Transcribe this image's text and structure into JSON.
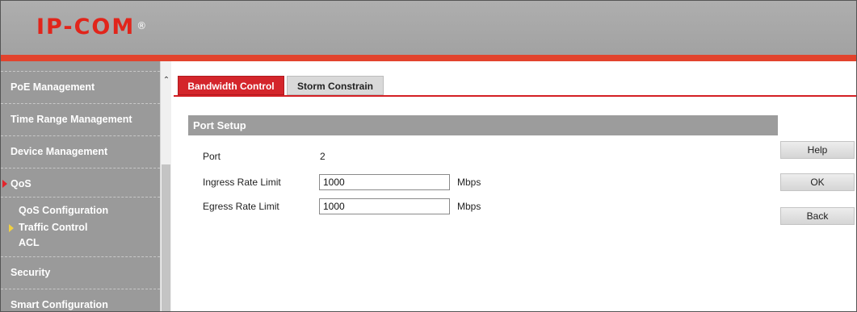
{
  "header": {
    "logo_text": "IP-COM",
    "logo_mark": "®",
    "brand_color": "#e1251b"
  },
  "sidebar": {
    "items": [
      {
        "label": "PoE Management"
      },
      {
        "label": "Time Range Management"
      },
      {
        "label": "Device Management"
      },
      {
        "label": "QoS",
        "expanded": true
      },
      {
        "label": "Security"
      },
      {
        "label": "Smart Configuration"
      }
    ],
    "qos_subitems": [
      {
        "label": "QoS Configuration"
      },
      {
        "label": "Traffic Control",
        "active": true
      },
      {
        "label": "ACL"
      }
    ]
  },
  "tabs": [
    {
      "label": "Bandwidth Control",
      "active": true
    },
    {
      "label": "Storm Constrain",
      "active": false
    }
  ],
  "section": {
    "title": "Port Setup",
    "port_label": "Port",
    "port_value": "2",
    "ingress_label": "Ingress Rate Limit",
    "ingress_value": "1000",
    "ingress_unit": "Mbps",
    "egress_label": "Egress Rate Limit",
    "egress_value": "1000",
    "egress_unit": "Mbps"
  },
  "buttons": {
    "help": "Help",
    "ok": "OK",
    "back": "Back"
  }
}
